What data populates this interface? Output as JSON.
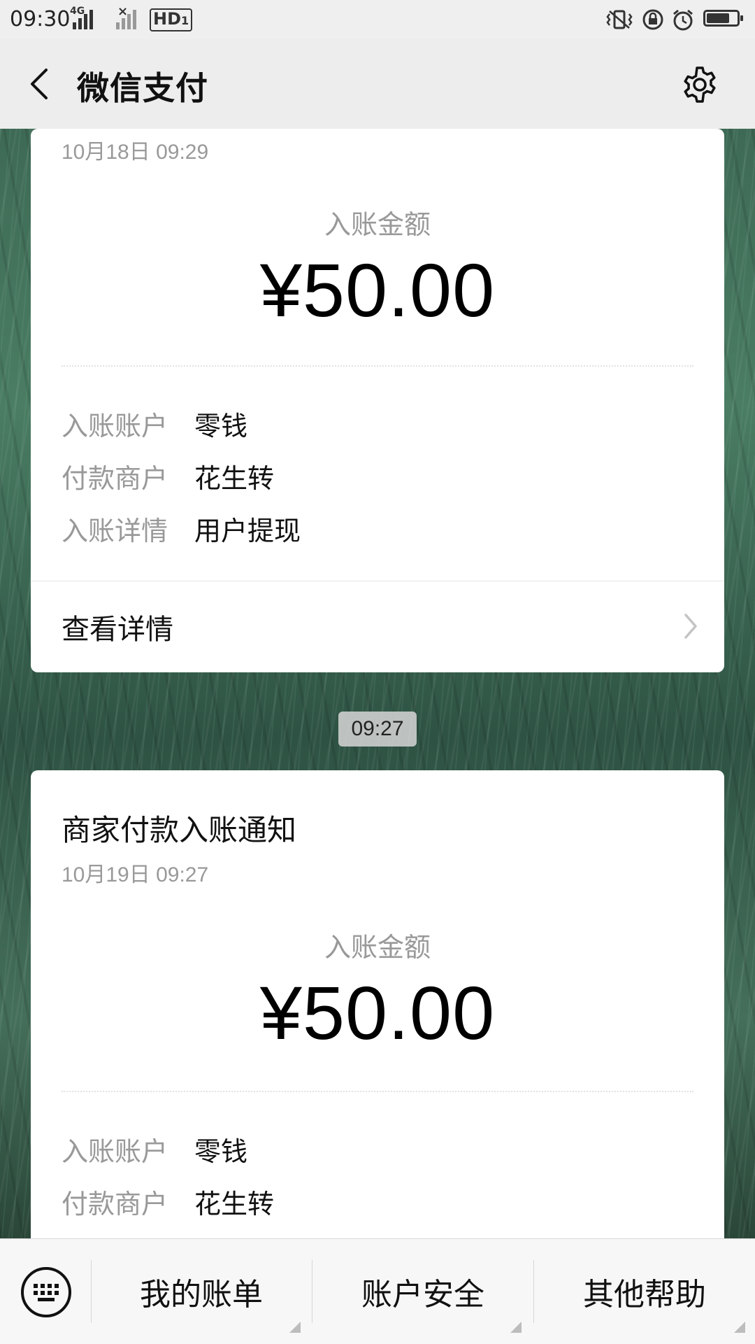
{
  "status_bar": {
    "time": "09:30",
    "net1": "4G",
    "net2": "×",
    "hd": "HD",
    "hd_sub": "1",
    "battery_level": 0.8
  },
  "header": {
    "title": "微信支付",
    "back_icon": "chevron-left-icon",
    "settings_icon": "gear-icon"
  },
  "messages": [
    {
      "date": "10月18日 09:29",
      "amount_label": "入账金额",
      "amount": "¥50.00",
      "rows": [
        {
          "key": "入账账户",
          "value": "零钱"
        },
        {
          "key": "付款商户",
          "value": "花生转"
        },
        {
          "key": "入账详情",
          "value": "用户提现"
        }
      ],
      "view_detail": "查看详情"
    },
    {
      "title": "商家付款入账通知",
      "date": "10月19日 09:27",
      "amount_label": "入账金额",
      "amount": "¥50.00",
      "rows": [
        {
          "key": "入账账户",
          "value": "零钱"
        },
        {
          "key": "付款商户",
          "value": "花生转"
        }
      ]
    }
  ],
  "time_divider": "09:27",
  "bottom_menu": {
    "keyboard_icon": "keyboard-icon",
    "items": [
      {
        "label": "我的账单"
      },
      {
        "label": "账户安全"
      },
      {
        "label": "其他帮助"
      }
    ]
  }
}
